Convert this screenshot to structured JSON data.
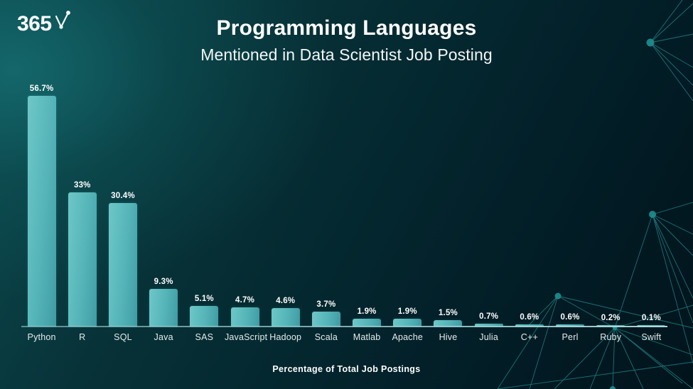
{
  "logo": {
    "text": "365",
    "mark_name": "data-point-checkmark"
  },
  "header": {
    "title": "Programming Languages",
    "subtitle": "Mentioned in Data Scientist Job Posting"
  },
  "caption": "Percentage of Total Job Postings",
  "colors": {
    "bar_light": "#6fc6c6",
    "bar_dark": "#3f9aa2",
    "bg_left": "#0d5054",
    "bg_right": "#01141c",
    "text": "#ffffff",
    "network_line": "#1f7f80"
  },
  "chart_data": {
    "type": "bar",
    "title": "Programming Languages",
    "subtitle": "Mentioned in Data Scientist Job Posting",
    "xlabel": "Percentage of Total Job Postings",
    "ylabel": "",
    "ylim": [
      0,
      60
    ],
    "grid": false,
    "legend": "none",
    "value_suffix": "%",
    "categories": [
      "Python",
      "R",
      "SQL",
      "Java",
      "SAS",
      "JavaScript",
      "Hadoop",
      "Scala",
      "Matlab",
      "Apache",
      "Hive",
      "Julia",
      "C++",
      "Perl",
      "Ruby",
      "Swift"
    ],
    "values": [
      56.7,
      33,
      30.4,
      9.3,
      5.1,
      4.7,
      4.6,
      3.7,
      1.9,
      1.9,
      1.5,
      0.7,
      0.6,
      0.6,
      0.2,
      0.1
    ],
    "labels": [
      "56.7%",
      "33%",
      "30.4%",
      "9.3%",
      "5.1%",
      "4.7%",
      "4.6%",
      "3.7%",
      "1.9%",
      "1.9%",
      "1.5%",
      "0.7%",
      "0.6%",
      "0.6%",
      "0.2%",
      "0.1%"
    ]
  }
}
